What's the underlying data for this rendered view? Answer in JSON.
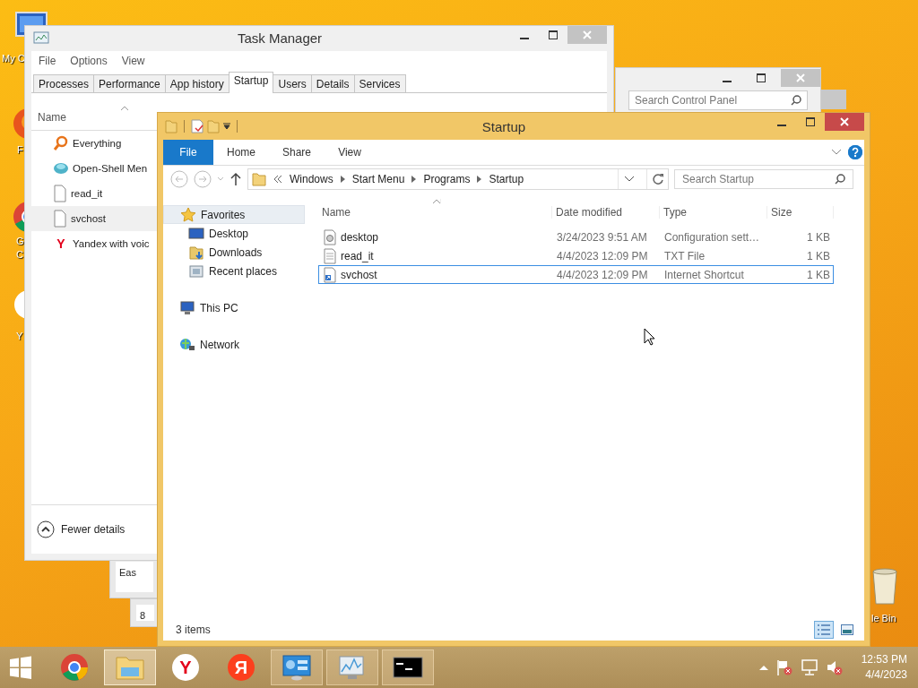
{
  "desktop_icons": [
    {
      "label": "My C",
      "kind": "computer"
    },
    {
      "label": "F",
      "kind": "firefox"
    },
    {
      "label": "G C",
      "kind": "chrome"
    },
    {
      "label": "Y",
      "kind": "yandex"
    },
    {
      "label": "le Bin",
      "kind": "bin"
    }
  ],
  "hidden_windows": [
    {
      "text": "Eas"
    },
    {
      "text": "8"
    }
  ],
  "control_panel": {
    "search": {
      "placeholder": "Search Control Panel"
    }
  },
  "task_manager": {
    "title": "Task Manager",
    "menu": [
      "File",
      "Options",
      "View"
    ],
    "tabs": [
      {
        "label": "Processes",
        "selected": false
      },
      {
        "label": "Performance",
        "selected": false
      },
      {
        "label": "App history",
        "selected": false
      },
      {
        "label": "Startup",
        "selected": true
      },
      {
        "label": "Users",
        "selected": false
      },
      {
        "label": "Details",
        "selected": false
      },
      {
        "label": "Services",
        "selected": false
      }
    ],
    "column": "Name",
    "rows": [
      {
        "name": "Everything",
        "kind": "search",
        "selected": false
      },
      {
        "name": "Open-Shell Men",
        "kind": "shell",
        "selected": false
      },
      {
        "name": "read_it",
        "kind": "file",
        "selected": false
      },
      {
        "name": "svchost",
        "kind": "file",
        "selected": true
      },
      {
        "name": "Yandex with voic",
        "kind": "glyph",
        "glyph": "Y",
        "selected": false
      }
    ],
    "footer": "Fewer details"
  },
  "explorer": {
    "title": "Startup",
    "ribbon_tabs": [
      {
        "label": "File",
        "selected": true
      },
      {
        "label": "Home",
        "selected": false
      },
      {
        "label": "Share",
        "selected": false
      },
      {
        "label": "View",
        "selected": false
      }
    ],
    "path": [
      "Windows",
      "Start Menu",
      "Programs",
      "Startup"
    ],
    "search": {
      "placeholder": "Search Startup"
    },
    "nav": [
      {
        "label": "Favorites",
        "kind": "star",
        "selected": true,
        "children": [
          {
            "label": "Desktop",
            "kind": "desktop",
            "selected": false
          },
          {
            "label": "Downloads",
            "kind": "downloads",
            "selected": false
          },
          {
            "label": "Recent places",
            "kind": "recent",
            "selected": false
          }
        ]
      },
      {
        "label": "This PC",
        "kind": "pc",
        "selected": false
      },
      {
        "label": "Network",
        "kind": "network",
        "selected": false
      }
    ],
    "columns": [
      "Name",
      "Date modified",
      "Type",
      "Size"
    ],
    "files": [
      {
        "name": "desktop",
        "date": "3/24/2023 9:51 AM",
        "type": "Configuration sett…",
        "size": "1 KB",
        "kind": "config",
        "selected": false
      },
      {
        "name": "read_it",
        "date": "4/4/2023 12:09 PM",
        "type": "TXT File",
        "size": "1 KB",
        "kind": "text",
        "selected": false
      },
      {
        "name": "svchost",
        "date": "4/4/2023 12:09 PM",
        "type": "Internet Shortcut",
        "size": "1 KB",
        "kind": "shortcut",
        "selected": true
      }
    ],
    "status": "3 items",
    "views": [
      {
        "kind": "details",
        "selected": true
      },
      {
        "kind": "tiles",
        "selected": false
      }
    ]
  },
  "taskbar": {
    "apps": [
      {
        "kind": "chrome",
        "running": false,
        "active": false
      },
      {
        "kind": "explorer",
        "running": true,
        "active": true
      },
      {
        "kind": "glyph",
        "glyph": "Y",
        "color": "#ffffff",
        "running": false,
        "active": false
      },
      {
        "kind": "glyph",
        "glyph": "Я",
        "color": "#fc3f1d",
        "running": false,
        "active": false
      },
      {
        "kind": "control-panel",
        "running": true,
        "active": false
      },
      {
        "kind": "monitor",
        "running": true,
        "active": false
      },
      {
        "kind": "console",
        "running": true,
        "active": false
      }
    ],
    "time": "12:53 PM",
    "date": "4/4/2023"
  }
}
